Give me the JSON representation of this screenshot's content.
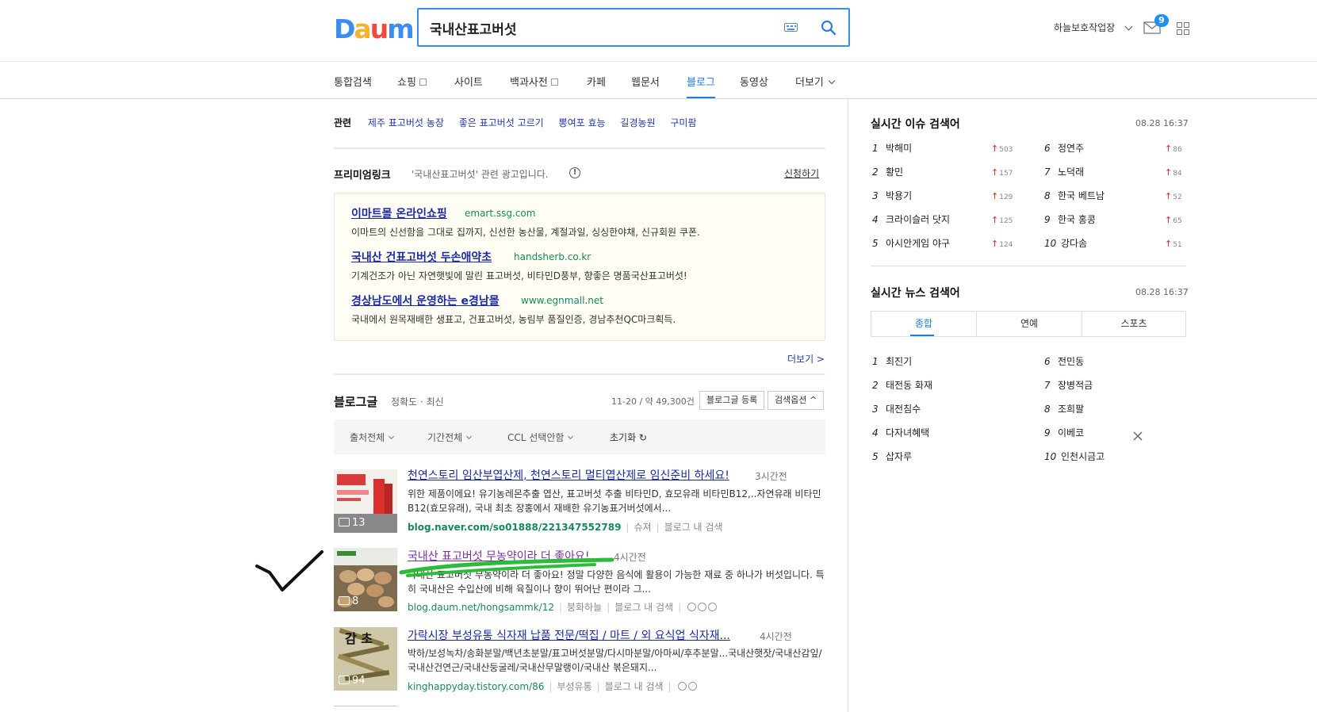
{
  "header": {
    "logo_text": "Daum",
    "search_value": "국내산표고버섯",
    "user_name": "하늘보호작업장",
    "mail_count": "9"
  },
  "gnb": {
    "tabs": [
      {
        "label": "통합검색"
      },
      {
        "label": "쇼핑"
      },
      {
        "label": "사이트"
      },
      {
        "label": "백과사전"
      },
      {
        "label": "카페"
      },
      {
        "label": "웹문서"
      },
      {
        "label": "블로그"
      },
      {
        "label": "동영상"
      },
      {
        "label": "더보기"
      }
    ],
    "active_tab": "블로그"
  },
  "related": {
    "label": "관련",
    "items": [
      "제주 표고버섯 농장",
      "좋은 표고버섯 고르기",
      "뽕여포 효능",
      "길경농원",
      "구미팜"
    ]
  },
  "premium": {
    "title": "프리미엄링크",
    "desc": "'국내산표고버섯' 관련 광고입니다.",
    "info": "!",
    "apply": "신청하기",
    "ads": [
      {
        "title": "이마트몰 온라인쇼핑",
        "url": "emart.ssg.com",
        "desc": "이마트의 신선함을 그대로 집까지, 신선한 농산물, 계절과일, 싱싱한야채, 신규회원 쿠폰."
      },
      {
        "title": "국내산 건표고버섯 두손애약초",
        "url": "handsherb.co.kr",
        "desc": "기계건조가 아닌 자연햇빛에 말린 표고버섯, 비타민D풍부, 향좋은 명품국산표고버섯!"
      },
      {
        "title": "경상남도에서 운영하는 e경남몰",
        "url": "www.egnmall.net",
        "desc": "국내에서 원목재배한 생표고, 건표고버섯, 농림부 품질인증, 경남추천QC마크획득."
      }
    ],
    "more": "더보기 >"
  },
  "blog": {
    "label": "블로그글",
    "sort": "정확도 · 최신",
    "count": "11-20 / 약 49,300건",
    "register_btn": "블로그글 등록",
    "options_btn": "검색옵션 ^",
    "filters": [
      "출처전체",
      "기간전체",
      "CCL 선택안함"
    ],
    "reset": "초기화 ↻",
    "results": [
      {
        "title": "천연스토리 임산부엽산제, 천연스토리 멀티엽산제로 임신준비 하세요!",
        "time": "3시간전",
        "desc": "위한 제품이에요! 유기농레몬추출 엽산, 표고버섯 추출 비타민D, 효모유래 비타민B12,..자연유래 비타민B12(효모유래), 국내 최초 장홍에서 재배한 유기농표거버섯에서...",
        "source": "blog.naver.com/so01888/221347552789",
        "author": "슈져",
        "search_in": "블로그 내 검색",
        "thumb_count": "13"
      },
      {
        "title": "국내산 표고버섯 무농약이라 더 좋아요!",
        "time": "4시간전",
        "desc": "국내산 표고버섯 무농약이라 더 좋아요! 정말 다양한 음식에 활용이 가능한 재료 중 하나가 버섯입니다. 특히 국내산은 수입산에 비해 육질이나 향이 뛰어난 편이라 그...",
        "source": "blog.daum.net/hongsammk/12",
        "author": "붕화하늘",
        "search_in": "블로그 내 검색",
        "thumb_count": "8"
      },
      {
        "title": "가락시장 부성유통 식자재 납품 전문/떡집 / 마트 / 외 요식업 식자재...",
        "time": "4시간전",
        "desc": "박하/보성녹차/송화분말/백년초분말/표고버섯분말/다시마분말/아마씨/후추분말...국내산햇잣/국내산감잎/국내산건연근/국내산둥굴레/국내산무말랭이/국내산 볶은돼지...",
        "source": "kinghappyday.tistory.com/86",
        "author": "부성유통",
        "search_in": "블로그 내 검색",
        "thumb_count": "94"
      }
    ]
  },
  "issue_ranking": {
    "title": "실시간 이슈 검색어",
    "time": "08.28  16:37",
    "items": [
      {
        "rank": "1",
        "term": "박해미",
        "delta": "503"
      },
      {
        "rank": "2",
        "term": "황민",
        "delta": "157"
      },
      {
        "rank": "3",
        "term": "박용기",
        "delta": "129"
      },
      {
        "rank": "4",
        "term": "크라이슬러 닷지",
        "delta": "125"
      },
      {
        "rank": "5",
        "term": "아시안게임 야구",
        "delta": "124"
      },
      {
        "rank": "6",
        "term": "정연주",
        "delta": "86"
      },
      {
        "rank": "7",
        "term": "노덕래",
        "delta": "84"
      },
      {
        "rank": "8",
        "term": "한국 베트남",
        "delta": "52"
      },
      {
        "rank": "9",
        "term": "한국 홍콩",
        "delta": "65"
      },
      {
        "rank": "10",
        "term": "강다솜",
        "delta": "51"
      }
    ]
  },
  "news_ranking": {
    "title": "실시간 뉴스 검색어",
    "time": "08.28  16:37",
    "tabs": [
      "종합",
      "연예",
      "스포츠"
    ],
    "items": [
      {
        "rank": "1",
        "term": "최진기"
      },
      {
        "rank": "2",
        "term": "태전동 화재"
      },
      {
        "rank": "3",
        "term": "대전침수"
      },
      {
        "rank": "4",
        "term": "다자녀혜택"
      },
      {
        "rank": "5",
        "term": "삽자루"
      },
      {
        "rank": "6",
        "term": "전민동"
      },
      {
        "rank": "7",
        "term": "장병적금"
      },
      {
        "rank": "8",
        "term": "조희팔"
      },
      {
        "rank": "9",
        "term": "이베코"
      },
      {
        "rank": "10",
        "term": "인천시금고"
      }
    ]
  },
  "colors": {
    "accent": "#1f7ee6",
    "link": "#1a2aa3",
    "source": "#16885f",
    "annotation": "#2dbb3a"
  }
}
